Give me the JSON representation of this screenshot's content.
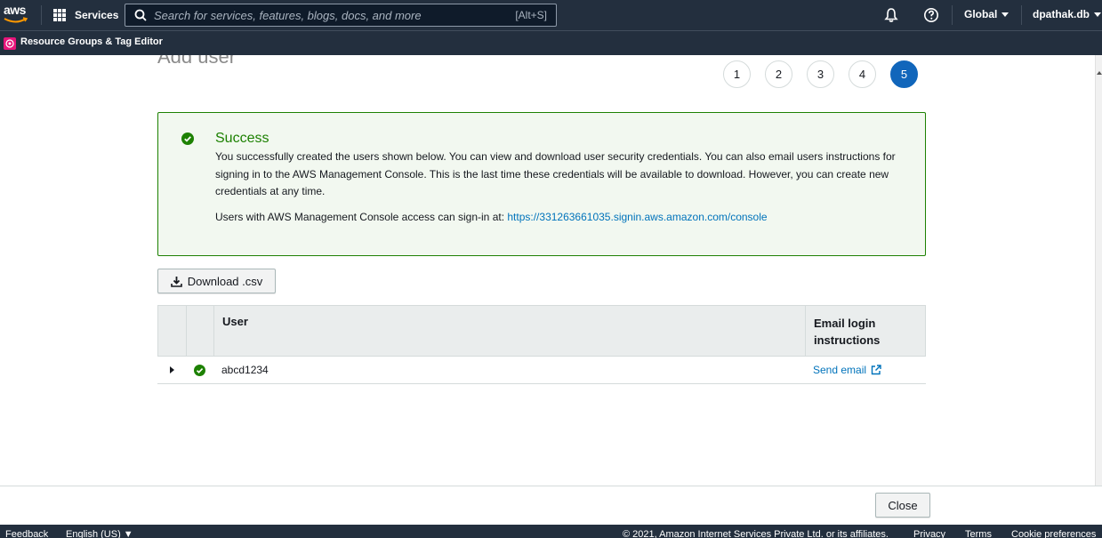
{
  "nav": {
    "logo_text": "aws",
    "services_label": "Services",
    "search_placeholder": "Search for services, features, blogs, docs, and more",
    "search_shortcut": "[Alt+S]",
    "region_label": "Global",
    "account_label": "dpathak.db"
  },
  "subnav": {
    "service_label": "Resource Groups & Tag Editor"
  },
  "page": {
    "title": "Add user",
    "steps": [
      "1",
      "2",
      "3",
      "4",
      "5"
    ],
    "active_step": "5"
  },
  "success": {
    "title": "Success",
    "message": "You successfully created the users shown below. You can view and download user security credentials. You can also email users instructions for signing in to the AWS Management Console. This is the last time these credentials will be available to download. However, you can create new credentials at any time.",
    "signin_prefix": "Users with AWS Management Console access can sign-in at: ",
    "signin_url": "https://331263661035.signin.aws.amazon.com/console"
  },
  "download_label": "Download .csv",
  "table": {
    "headers": {
      "user": "User",
      "email": "Email login instructions"
    },
    "rows": [
      {
        "user": "abcd1234",
        "email_action": "Send email"
      }
    ]
  },
  "close_label": "Close",
  "footer": {
    "feedback": "Feedback",
    "language": "English (US) ▼",
    "copyright": "© 2021, Amazon Internet Services Private Ltd. or its affiliates.",
    "privacy": "Privacy",
    "terms": "Terms",
    "cookies": "Cookie preferences"
  },
  "colors": {
    "nav_bg": "#232f3e",
    "success_green": "#1d8102",
    "link_blue": "#0073bb",
    "active_step": "#1166bb"
  }
}
